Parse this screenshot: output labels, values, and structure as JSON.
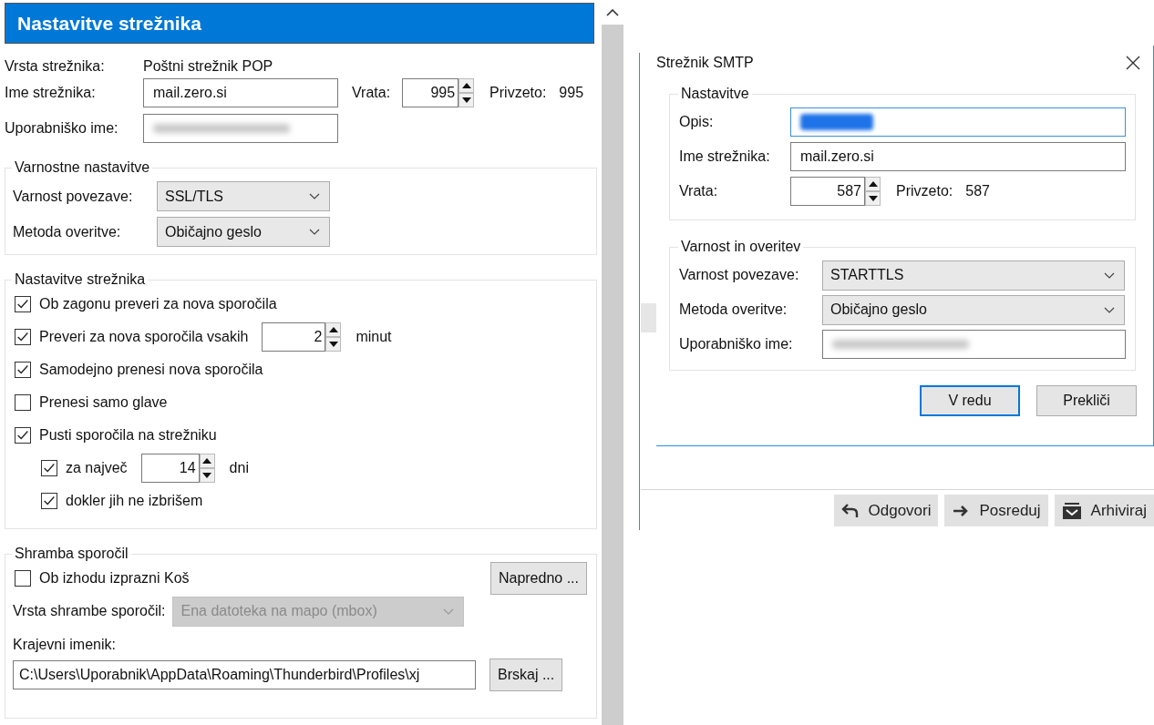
{
  "header": {
    "title": "Nastavitve strežnika"
  },
  "server": {
    "type_label": "Vrsta strežnika:",
    "type_value": "Poštni strežnik POP",
    "name_label": "Ime strežnika:",
    "name_value": "mail.zero.si",
    "port_label": "Vrata:",
    "port_value": "995",
    "default_label": "Privzeto:",
    "default_value": "995",
    "user_label": "Uporabniško ime:"
  },
  "security": {
    "legend": "Varnostne nastavitve",
    "rows": [
      {
        "label": "Varnost povezave:",
        "value": "SSL/TLS"
      },
      {
        "label": "Metoda overitve:",
        "value": "Običajno geslo"
      }
    ]
  },
  "settings": {
    "legend": "Nastavitve strežnika",
    "options": [
      {
        "kind": "check",
        "label": "Ob zagonu preveri za nova sporočila",
        "checked": true
      },
      {
        "kind": "interval",
        "label": "Preveri za nova sporočila vsakih",
        "checked": true,
        "value": "2",
        "unit": "minut"
      },
      {
        "kind": "check",
        "label": "Samodejno prenesi nova sporočila",
        "checked": true
      },
      {
        "kind": "check",
        "label": "Prenesi samo glave",
        "checked": false
      },
      {
        "kind": "check",
        "label": "Pusti sporočila na strežniku",
        "checked": true,
        "children": [
          {
            "kind": "interval",
            "label": "za največ",
            "checked": true,
            "value": "14",
            "unit": "dni"
          },
          {
            "kind": "check",
            "label": "dokler jih ne izbrišem",
            "checked": true
          }
        ]
      }
    ]
  },
  "storage": {
    "legend": "Shramba sporočil",
    "empty_trash": {
      "label": "Ob izhodu izprazni Koš",
      "checked": false
    },
    "advanced_button": "Napredno ...",
    "store_type": {
      "label": "Vrsta shrambe sporočil:",
      "value": "Ena datoteka na mapo (mbox)",
      "disabled": true
    },
    "local_dir": {
      "label": "Krajevni imenik:",
      "value": "C:\\Users\\Uporabnik\\AppData\\Roaming\\Thunderbird\\Profiles\\xj"
    },
    "browse_button": "Brskaj ..."
  },
  "dialog": {
    "title": "Strežnik SMTP",
    "settings_legend": "Nastavitve",
    "description_label": "Opis:",
    "name_label": "Ime strežnika:",
    "name_value": "mail.zero.si",
    "port_label": "Vrata:",
    "port_value": "587",
    "default_label": "Privzeto:",
    "default_value": "587",
    "security_legend": "Varnost in overitev",
    "rows": [
      {
        "label": "Varnost povezave:",
        "value": "STARTTLS"
      },
      {
        "label": "Metoda overitve:",
        "value": "Običajno geslo"
      }
    ],
    "user_label": "Uporabniško ime:",
    "buttons": [
      {
        "label": "V redu",
        "default": true
      },
      {
        "label": "Prekliči",
        "default": false
      }
    ]
  },
  "toolbar": [
    {
      "kind": "reply",
      "label": "Odgovori"
    },
    {
      "kind": "forward",
      "label": "Posreduj"
    },
    {
      "kind": "archive",
      "label": "Arhiviraj"
    }
  ]
}
